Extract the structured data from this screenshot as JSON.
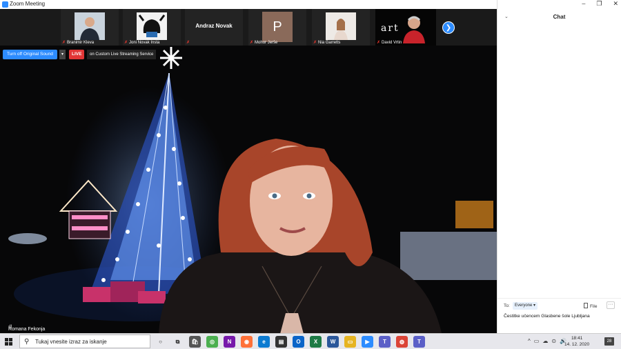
{
  "window": {
    "title": "Zoom Meeting"
  },
  "participants": [
    {
      "name": "Branimir Kleva",
      "type": "photo"
    },
    {
      "name": "Joni Novak Insta",
      "type": "photo"
    },
    {
      "name": "",
      "display_name": "Andraz Novak",
      "type": "name-only"
    },
    {
      "name": "Mohor Jerše",
      "letter": "P",
      "type": "letter"
    },
    {
      "name": "Nia Garretts",
      "type": "photo"
    },
    {
      "name": "David Vrtin",
      "tile_text": "art",
      "type": "photo"
    }
  ],
  "controls": {
    "original_sound": "Turn off Original Sound",
    "caret": "▾",
    "live_badge": "LIVE",
    "live_text": "on Custom Live Streaming Service",
    "next_arrow": "❯"
  },
  "speaker": {
    "name": "Romana Fekonja"
  },
  "chat": {
    "title": "Chat",
    "collapse_caret": "⌄",
    "to_label": "To:",
    "to_value": "Everyone ▾",
    "file_label": "File",
    "more_label": "···",
    "message_text": "Čestitke učencem Glasbene šole Ljubljana"
  },
  "window_controls": {
    "minimize": "–",
    "restore": "❐",
    "close": "✕"
  },
  "taskbar": {
    "search_placeholder": "Tukaj vnesite izraz za iskanje",
    "time": "18:41",
    "date": "14. 12. 2020",
    "notifications": "28",
    "apps": [
      {
        "name": "cortana",
        "label": "○",
        "color": "#e7e7ec"
      },
      {
        "name": "task-view",
        "label": "⧉",
        "color": "#e7e7ec"
      },
      {
        "name": "store",
        "label": "🛍",
        "color": "#555"
      },
      {
        "name": "chrome-ext",
        "label": "◎",
        "color": "#4caf50"
      },
      {
        "name": "onenote",
        "label": "N",
        "color": "#7719aa"
      },
      {
        "name": "firefox",
        "label": "◉",
        "color": "#ff7139"
      },
      {
        "name": "edge",
        "label": "e",
        "color": "#0c7bd1"
      },
      {
        "name": "sticky",
        "label": "▤",
        "color": "#333"
      },
      {
        "name": "outlook",
        "label": "O",
        "color": "#0a64c8"
      },
      {
        "name": "excel",
        "label": "X",
        "color": "#1d7a45"
      },
      {
        "name": "word",
        "label": "W",
        "color": "#2b579a"
      },
      {
        "name": "explorer",
        "label": "▭",
        "color": "#e6b422"
      },
      {
        "name": "zoom",
        "label": "▶",
        "color": "#2d8cff"
      },
      {
        "name": "teams",
        "label": "T",
        "color": "#5b5fc7"
      },
      {
        "name": "chrome",
        "label": "◍",
        "color": "#db4437"
      },
      {
        "name": "teams-2",
        "label": "T",
        "color": "#5b5fc7"
      }
    ],
    "tray": [
      "^",
      "▭",
      "☁",
      "⊙",
      "🔊"
    ]
  }
}
